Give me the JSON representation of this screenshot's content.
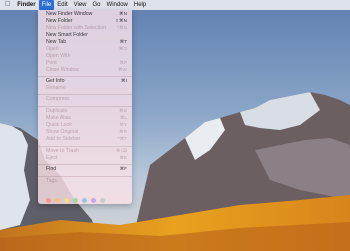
{
  "menubar": {
    "apple_icon": "apple-icon",
    "app_name": "Finder",
    "items": [
      "File",
      "Edit",
      "View",
      "Go",
      "Window",
      "Help"
    ],
    "active_menu": "File"
  },
  "file_menu": {
    "items": [
      {
        "label": "New Finder Window",
        "shortcut": "⌘N",
        "enabled": true
      },
      {
        "label": "New Folder",
        "shortcut": "⇧⌘N",
        "enabled": true
      },
      {
        "label": "New Folder with Selection",
        "shortcut": "^⌘N",
        "enabled": false
      },
      {
        "label": "New Smart Folder",
        "shortcut": "",
        "enabled": true
      },
      {
        "label": "New Tab",
        "shortcut": "⌘T",
        "enabled": true
      },
      {
        "label": "Open",
        "shortcut": "⌘O",
        "enabled": false
      },
      {
        "label": "Open With",
        "shortcut": "",
        "enabled": false
      },
      {
        "label": "Print",
        "shortcut": "⌘P",
        "enabled": false
      },
      {
        "label": "Close Window",
        "shortcut": "⌘W",
        "enabled": false
      },
      {
        "label": "Get Info",
        "shortcut": "⌘I",
        "enabled": true
      },
      {
        "label": "Rename",
        "shortcut": "",
        "enabled": false
      },
      {
        "label": "Compress",
        "shortcut": "",
        "enabled": false
      },
      {
        "label": "Duplicate",
        "shortcut": "⌘D",
        "enabled": false
      },
      {
        "label": "Make Alias",
        "shortcut": "⌘L",
        "enabled": false
      },
      {
        "label": "Quick Look",
        "shortcut": "⌘Y",
        "enabled": false
      },
      {
        "label": "Show Original",
        "shortcut": "⌘R",
        "enabled": false
      },
      {
        "label": "Add to Sidebar",
        "shortcut": "^⌘T",
        "enabled": false
      },
      {
        "label": "Move to Trash",
        "shortcut": "⌘⌫",
        "enabled": false
      },
      {
        "label": "Eject",
        "shortcut": "⌘E",
        "enabled": false
      },
      {
        "label": "Find",
        "shortcut": "⌘F",
        "enabled": true
      },
      {
        "label": "Tags…",
        "shortcut": "",
        "enabled": false
      }
    ],
    "tag_colors": [
      "#f29a8c",
      "#f6bf86",
      "#f3dd8a",
      "#a8d69a",
      "#9fc0ec",
      "#c6a8e2",
      "#c9c9cf"
    ]
  }
}
